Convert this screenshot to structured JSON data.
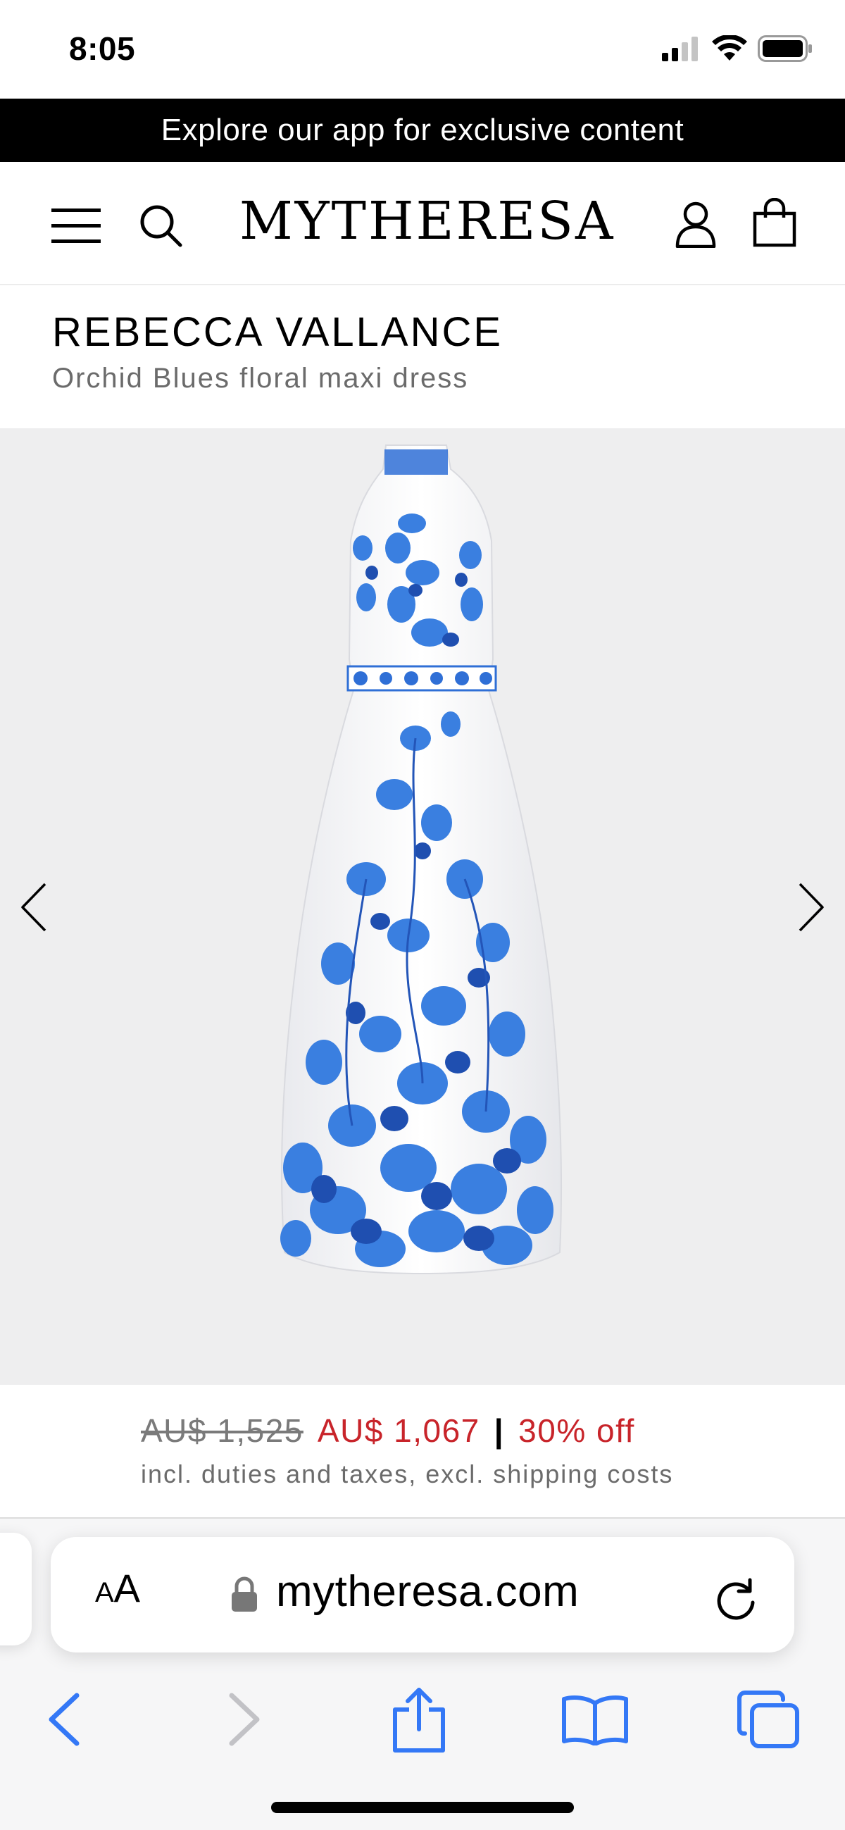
{
  "status_bar": {
    "time": "8:05"
  },
  "promo_banner": {
    "text": "Explore our app for exclusive content"
  },
  "header": {
    "logo": "MYTHERESA"
  },
  "product": {
    "brand": "REBECCA VALLANCE",
    "name": "Orchid Blues floral maxi dress"
  },
  "price": {
    "original": "AU$ 1,525",
    "sale": "AU$ 1,067",
    "separator": "|",
    "discount": "30% off",
    "note": "incl. duties and taxes, excl. shipping costs"
  },
  "browser": {
    "aa_small": "A",
    "aa_big": "A",
    "url": "mytheresa.com"
  },
  "colors": {
    "sale_red": "#c8242a",
    "safari_blue": "#3478f6",
    "print_blue": "#2f6fd6"
  },
  "icons": [
    "signal-icon",
    "wifi-icon",
    "battery-icon",
    "menu-icon",
    "search-icon",
    "account-icon",
    "bag-icon",
    "chevron-left-icon",
    "chevron-right-icon",
    "lock-icon",
    "reload-icon",
    "back-icon",
    "forward-icon",
    "share-icon",
    "bookmarks-icon",
    "tabs-icon"
  ]
}
